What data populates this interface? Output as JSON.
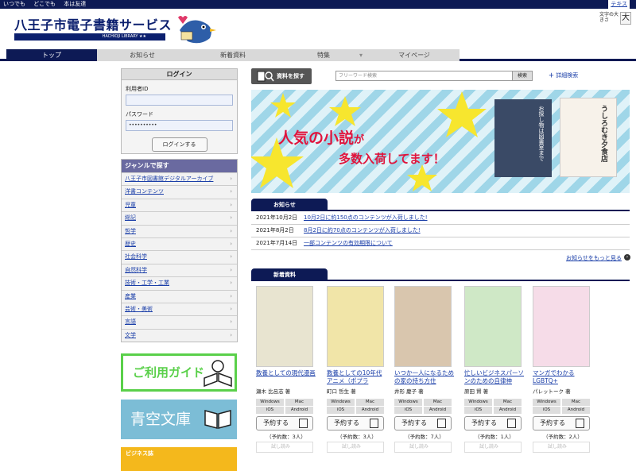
{
  "topbar": {
    "links": [
      "いつでも",
      "どこでも",
      "本は友達"
    ],
    "text_button": "テキス"
  },
  "logo": {
    "title": "八王子市電子書籍サービス",
    "sub": "HACHIOJI LIBRARY ★★"
  },
  "fontsize": {
    "label": "文字の大きさ",
    "big": "大"
  },
  "nav": {
    "tabs": [
      "トップ",
      "お知らせ",
      "新着資料",
      "特集",
      "マイページ"
    ]
  },
  "login": {
    "title": "ログイン",
    "user_label": "利用者ID",
    "user_value": "",
    "pass_label": "パスワード",
    "pass_value": "••••••••••",
    "button": "ログインする"
  },
  "genre": {
    "title": "ジャンルで探す",
    "items": [
      "八王子市図書館デジタルアーカイブ",
      "洋書コンテンツ",
      "児童",
      "総記",
      "哲学",
      "歴史",
      "社会科学",
      "自然科学",
      "技術・工学・工業",
      "産業",
      "芸術・美術",
      "言語",
      "文学"
    ]
  },
  "banners": {
    "guide": "ご利用ガイド",
    "aozora": "青空文庫",
    "biz": "ビジネス誌"
  },
  "search": {
    "button": "資料を探す",
    "placeholder": "フリーワード検索",
    "go": "検索",
    "advanced": "詳細検索"
  },
  "hero": {
    "headline_1": "人気の小説",
    "headline_2": "が",
    "subline": "多数入荷してます！",
    "book1": "お探し物は図書室まで",
    "book2": "うしろむき夕食店"
  },
  "news": {
    "title": "お知らせ",
    "items": [
      {
        "date": "2021年10月2日",
        "text": "10月2日に約150点のコンテンツが入荷しました!"
      },
      {
        "date": "2021年8月2日",
        "text": "8月2日に約70点のコンテンツが入荷しました!"
      },
      {
        "date": "2021年7月14日",
        "text": "一部コンテンツの有効期限について"
      }
    ],
    "more": "お知らせをもっと見る"
  },
  "newarrivals": {
    "title": "新着資料",
    "books": [
      {
        "title": "教養としての現代漫画",
        "author": "瀬木 比呂志 著",
        "count": "（予約数：3人）",
        "color": "#e8e4d0"
      },
      {
        "title": "教養としての10年代アニメ（ポプラ",
        "author": "町口 哲生 著",
        "count": "（予約数：3人）",
        "color": "#f1e5a8"
      },
      {
        "title": "いつか一人になるための家の持ち方住",
        "author": "井形 慶子 著",
        "count": "（予約数：7人）",
        "color": "#d9c6ae"
      },
      {
        "title": "忙しいビジネスパーソンのための自律神",
        "author": "原田 賢 著",
        "count": "（予約数：1人）",
        "color": "#cfe8c6"
      },
      {
        "title": "マンガでわかるLGBTQ+",
        "author": "パレットーク 著",
        "count": "（予約数：2人）",
        "color": "#f6dce8"
      }
    ],
    "formats": [
      "Windows",
      "Mac",
      "iOS",
      "Android"
    ],
    "reserve": "予約する",
    "trial": "試し読み"
  },
  "colors": {
    "navy": "#0d1a55",
    "guide_green": "#5ad04a",
    "aozora_blue": "#7cbdd6",
    "biz_yellow": "#f4b81c",
    "hero_red": "#e0143c"
  }
}
